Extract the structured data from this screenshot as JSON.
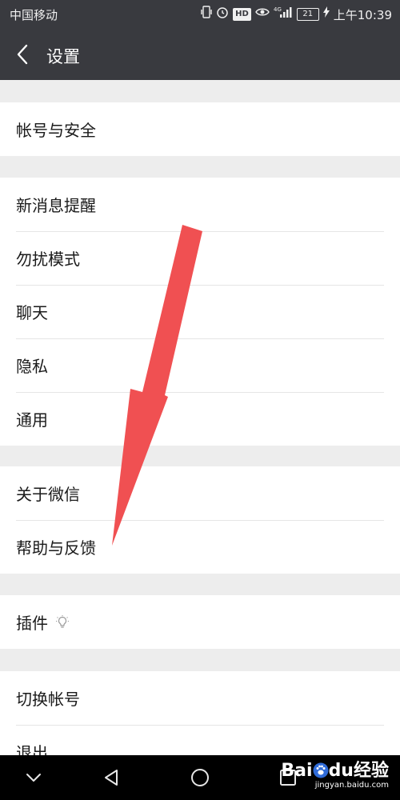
{
  "status_bar": {
    "carrier": "中国移动",
    "network": "4G",
    "battery": "21",
    "time": "上午10:39",
    "hd_label": "HD"
  },
  "header": {
    "title": "设置"
  },
  "groups": [
    {
      "items": [
        {
          "label": "帐号与安全"
        }
      ]
    },
    {
      "items": [
        {
          "label": "新消息提醒"
        },
        {
          "label": "勿扰模式"
        },
        {
          "label": "聊天"
        },
        {
          "label": "隐私"
        },
        {
          "label": "通用"
        }
      ]
    },
    {
      "items": [
        {
          "label": "关于微信"
        },
        {
          "label": "帮助与反馈"
        }
      ]
    },
    {
      "items": [
        {
          "label": "插件",
          "icon": "lightbulb-icon"
        }
      ]
    },
    {
      "items": [
        {
          "label": "切换帐号"
        },
        {
          "label": "退出"
        }
      ]
    }
  ],
  "watermark": {
    "main": "Bai",
    "paw": "du",
    "suffix": "经验",
    "url": "jingyan.baidu.com"
  },
  "colors": {
    "header_bg": "#393a3f",
    "page_bg": "#ededed",
    "arrow": "#f05052"
  }
}
